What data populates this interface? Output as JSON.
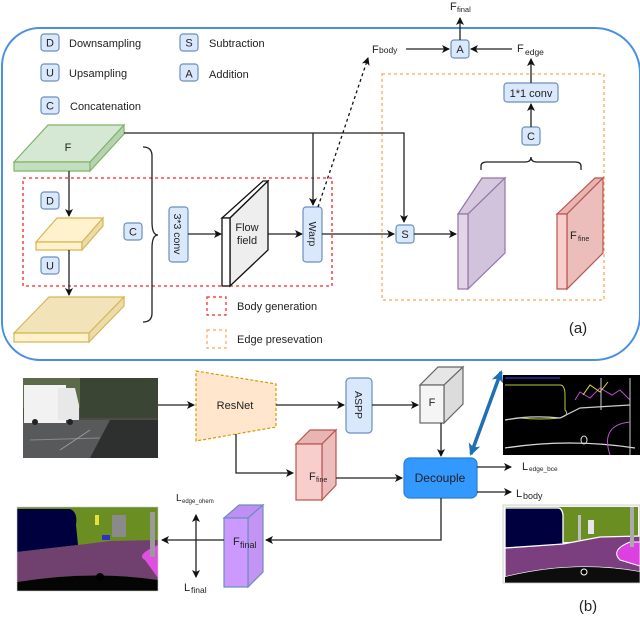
{
  "legend": {
    "items": [
      {
        "symbol": "D",
        "label": "Downsampling"
      },
      {
        "symbol": "U",
        "label": "Upsampling"
      },
      {
        "symbol": "C",
        "label": "Concatenation"
      },
      {
        "symbol": "S",
        "label": "Subtraction"
      },
      {
        "symbol": "A",
        "label": "Addition"
      }
    ],
    "regions": [
      {
        "label": "Body generation",
        "color": "#ff0000"
      },
      {
        "label": "Edge presevation",
        "color": "#ffa64d"
      }
    ]
  },
  "part_a": {
    "caption": "(a)",
    "feature_f": "F",
    "op_d": "D",
    "op_u": "U",
    "op_c_left": "C",
    "conv3": "3*3 conv",
    "flow_field_line1": "Flow",
    "flow_field_line2": "field",
    "warp": "Warp",
    "op_s": "S",
    "op_c_right": "C",
    "conv1": "1*1 conv",
    "op_a": "A",
    "f_body_main": "F",
    "f_body_sub": "body",
    "f_edge_main": "F",
    "f_edge_sub": "edge",
    "f_final_main": "F",
    "f_final_sub": "final",
    "f_fine_main": "F",
    "f_fine_sub": "fine"
  },
  "part_b": {
    "caption": "(b)",
    "resnet": "ResNet",
    "aspp": "ASPP",
    "feature_f": "F",
    "decouple": "Decouple",
    "f_fine_main": "F",
    "f_fine_sub": "fine",
    "f_final_main": "F",
    "f_final_sub": "final",
    "l_edge_bce_main": "L",
    "l_edge_bce_sub": "edge_bce",
    "l_body_main": "L",
    "l_body_sub": "body",
    "l_edge_ohem_main": "L",
    "l_edge_ohem_sub": "edge_ohem",
    "l_final_main": "L",
    "l_final_sub": "final"
  },
  "colors": {
    "outer_frame": "#4a90e2",
    "op_box_fill": "#dae8fc",
    "op_box_stroke": "#6c8ebf",
    "feature_green": "#d5e8d4",
    "feature_yellow": "#fff2cc",
    "feature_purple": "#e1d5e7",
    "feature_red": "#f8cecc",
    "decouple_blue": "#3399ff",
    "final_violet": "#cc99ff",
    "double_arrow": "#1f6fb2"
  }
}
